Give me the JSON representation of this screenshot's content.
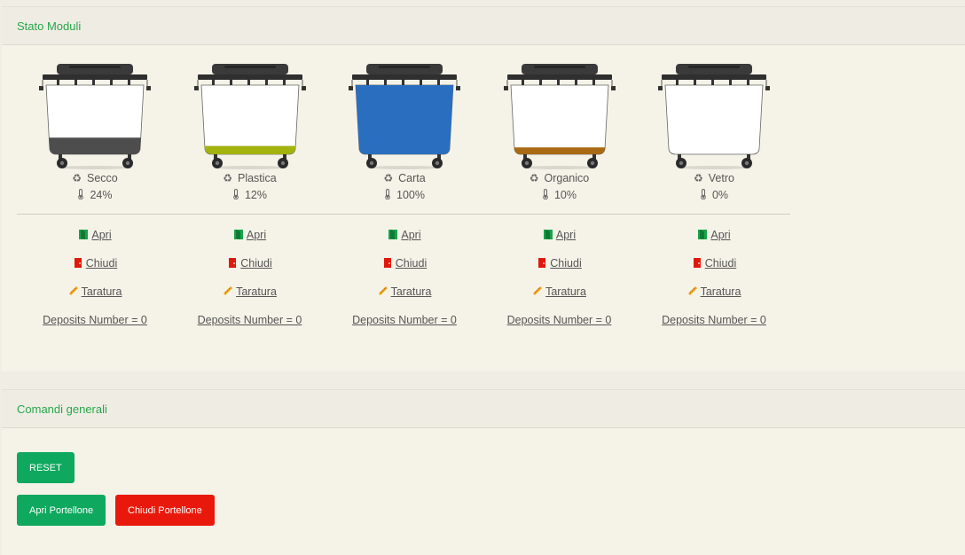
{
  "stato_moduli": {
    "title": "Stato Moduli",
    "modules": [
      {
        "name": "Secco",
        "fill_percent": "24%",
        "fill_level": 0.24,
        "color": "#4d4d4d",
        "open": "Apri",
        "close": "Chiudi",
        "calibrate": "Taratura",
        "deposits": "Deposits Number = 0"
      },
      {
        "name": "Plastica",
        "fill_percent": "12%",
        "fill_level": 0.12,
        "color": "#a3b20f",
        "open": "Apri",
        "close": "Chiudi",
        "calibrate": "Taratura",
        "deposits": "Deposits Number = 0"
      },
      {
        "name": "Carta",
        "fill_percent": "100%",
        "fill_level": 1.0,
        "color": "#2a6fbf",
        "open": "Apri",
        "close": "Chiudi",
        "calibrate": "Taratura",
        "deposits": "Deposits Number = 0"
      },
      {
        "name": "Organico",
        "fill_percent": "10%",
        "fill_level": 0.1,
        "color": "#a86a12",
        "open": "Apri",
        "close": "Chiudi",
        "calibrate": "Taratura",
        "deposits": "Deposits Number = 0"
      },
      {
        "name": "Vetro",
        "fill_percent": "0%",
        "fill_level": 0.0,
        "color": "#ffffff",
        "open": "Apri",
        "close": "Chiudi",
        "calibrate": "Taratura",
        "deposits": "Deposits Number = 0"
      }
    ],
    "icons": {
      "type": "recycle-icon",
      "level": "thermometer-icon",
      "open": "door-open-icon",
      "close": "door-closed-icon",
      "calibrate": "ruler-icon"
    }
  },
  "comandi_generali": {
    "title": "Comandi generali",
    "reset_label": "RESET",
    "open_label": "Apri Portellone",
    "close_label": "Chiudi Portellone"
  },
  "colors": {
    "accent_green": "#27a64b",
    "button_green": "#0ea85e",
    "button_red": "#e8190c",
    "open_icon": "#1aa34a",
    "close_icon": "#e0180c",
    "ruler_icon": "#f0a21a"
  }
}
